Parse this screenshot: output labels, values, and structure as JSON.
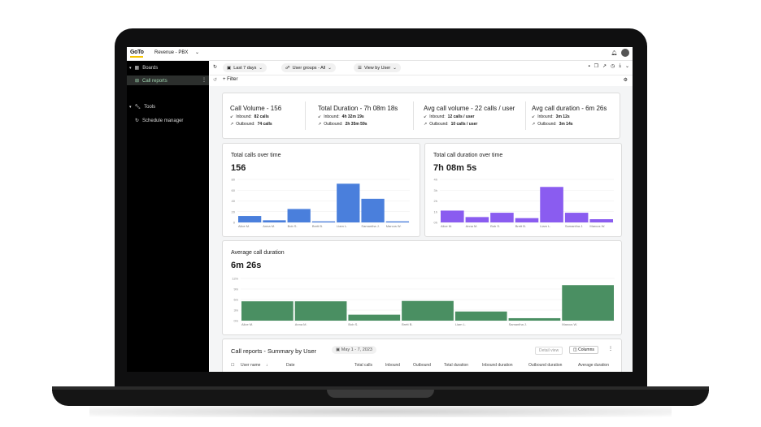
{
  "app": {
    "logo": "GoTo",
    "title": "Revenue - PBX"
  },
  "sidebar": {
    "boards": "Boards",
    "call_reports": "Call reports",
    "tools": "Tools",
    "schedule_manager": "Schedule manager"
  },
  "toolbar": {
    "date_range": "Last 7 days",
    "user_groups": "User groups - All",
    "view_by": "View by User",
    "filter": "+ Filter"
  },
  "summary": [
    {
      "title": "Call Volume - 156",
      "inbound": "Inbound:",
      "inbound_val": "82 calls",
      "outbound": "Outbound:",
      "outbound_val": "74 calls"
    },
    {
      "title": "Total Duration - 7h 08m 18s",
      "inbound": "Inbound:",
      "inbound_val": "4h 32m 19s",
      "outbound": "Outbound:",
      "outbound_val": "2h 35m 59s"
    },
    {
      "title": "Avg call volume - 22 calls / user",
      "inbound": "Inbound:",
      "inbound_val": "12 calls / user",
      "outbound": "Outbound:",
      "outbound_val": "10 calls / user"
    },
    {
      "title": "Avg call duration - 6m 26s",
      "inbound": "Inbound:",
      "inbound_val": "3m 12s",
      "outbound": "Outbound:",
      "outbound_val": "3m 14s"
    }
  ],
  "chart_data": [
    {
      "type": "bar",
      "title": "Total calls over time",
      "value_text": "156",
      "categories": [
        "Alice M.",
        "Anna M.",
        "Bob S.",
        "Brett B.",
        "Liam L.",
        "Samantha J.",
        "Marcus W."
      ],
      "values": [
        12,
        4,
        25,
        2,
        72,
        44,
        2
      ],
      "yticks": [
        "80",
        "60",
        "40",
        "20",
        "0"
      ],
      "ylim": [
        0,
        80
      ],
      "color": "#4a7fdc"
    },
    {
      "type": "bar",
      "title": "Total call duration over time",
      "value_text": "7h 08m 5s",
      "categories": [
        "Alice M.",
        "Anna M.",
        "Bob S.",
        "Brett B.",
        "Liam L.",
        "Samantha J.",
        "Marcus W."
      ],
      "values": [
        1.1,
        0.5,
        0.9,
        0.4,
        3.3,
        0.9,
        0.3
      ],
      "yticks": [
        "4h",
        "3h",
        "2h",
        "1h",
        "0h"
      ],
      "ylim": [
        0,
        4
      ],
      "color": "#8a5cf0"
    },
    {
      "type": "bar",
      "title": "Average call duration",
      "value_text": "6m 26s",
      "categories": [
        "Alice M.",
        "Anna M.",
        "Bob S.",
        "Brett B.",
        "Liam L.",
        "Samantha J.",
        "Marcus W."
      ],
      "values": [
        5.5,
        5.5,
        1.7,
        5.6,
        2.6,
        0.7,
        10.1
      ],
      "yticks": [
        "12m",
        "9m",
        "6m",
        "3m",
        "0m"
      ],
      "ylim": [
        0,
        12
      ],
      "color": "#4a8f62"
    }
  ],
  "table": {
    "title": "Call reports - Summary by User",
    "date_chip": "May 1 - 7, 2023",
    "detail_view": "Detail view",
    "columns_btn": "Columns",
    "headers": [
      "User name",
      "Date",
      "Total calls",
      "Inbound",
      "Outbound",
      "Total duration",
      "Inbound duration",
      "Outbound duration",
      "Average duration"
    ]
  }
}
